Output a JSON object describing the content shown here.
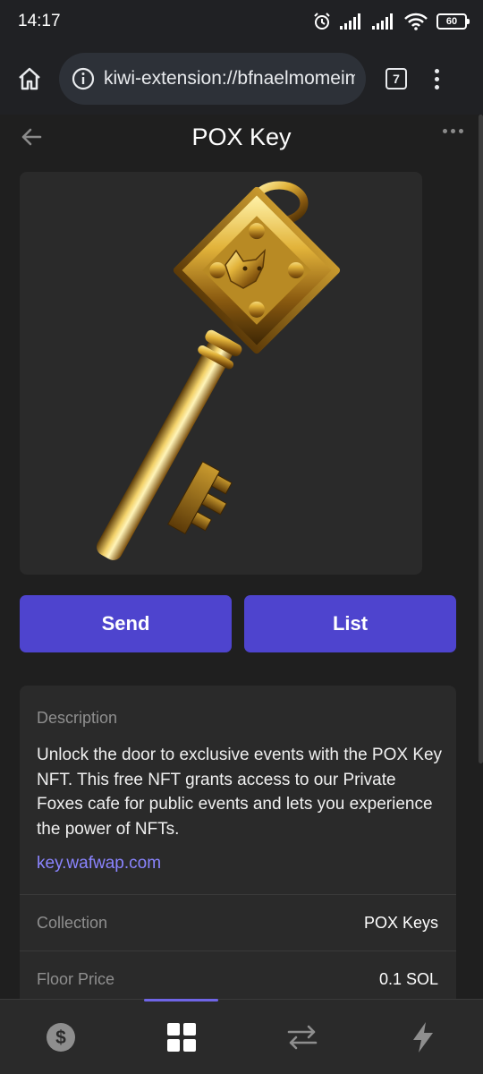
{
  "status_bar": {
    "time": "14:17",
    "battery": "60"
  },
  "browser": {
    "url": "kiwi-extension://bfnaelmomeimhlpmgjnjophhpkkoljpa",
    "tab_count": "7"
  },
  "header": {
    "title": "POX Key"
  },
  "actions": {
    "send_label": "Send",
    "list_label": "List"
  },
  "details": {
    "description_label": "Description",
    "description_text": "Unlock the door to exclusive events with the POX Key NFT. This free NFT grants access to our Private Foxes cafe for public events and lets you experience the power of NFTs.",
    "link_text": "key.wafwap.com",
    "rows": [
      {
        "label": "Collection",
        "value": "POX Keys"
      },
      {
        "label": "Floor Price",
        "value": "0.1 SOL"
      }
    ]
  },
  "bottom_nav": {
    "items": [
      {
        "icon": "dollar-icon",
        "active": false
      },
      {
        "icon": "grid-icon",
        "active": true
      },
      {
        "icon": "swap-icon",
        "active": false
      },
      {
        "icon": "bolt-icon",
        "active": false
      }
    ]
  },
  "colors": {
    "accent": "#4e44ce",
    "link": "#8a84ff",
    "background": "#1f1f1f",
    "card": "#2a2a2a"
  }
}
